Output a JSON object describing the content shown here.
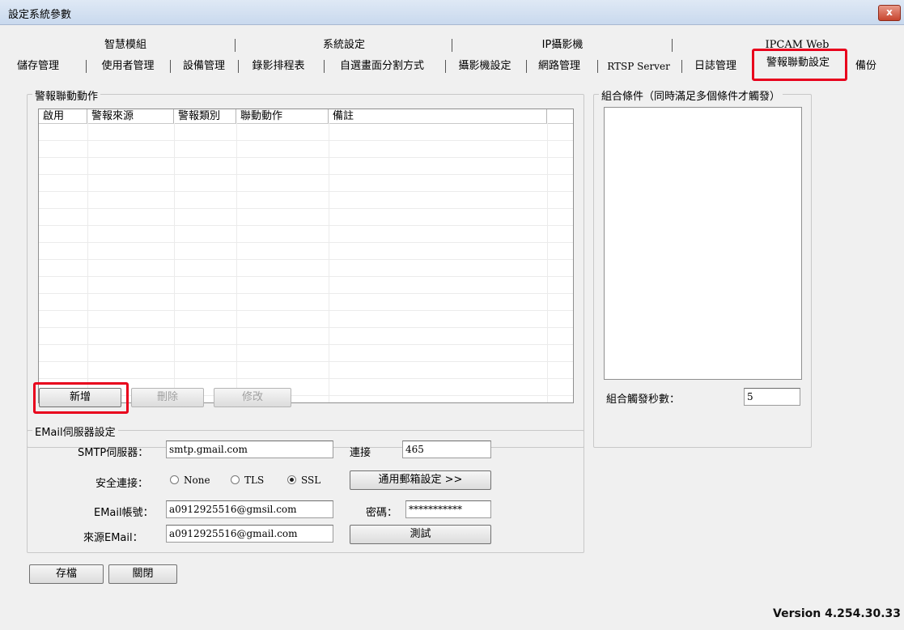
{
  "window": {
    "title": "設定系統參數",
    "close_label": "x"
  },
  "tabs": {
    "top_row": [
      "智慧模組",
      "系統設定",
      "IP攝影機",
      "IPCAM Web"
    ],
    "bottom_row": [
      "儲存管理",
      "使用者管理",
      "設備管理",
      "錄影排程表",
      "自選畫面分割方式",
      "攝影機設定",
      "網路管理",
      "RTSP Server",
      "日誌管理",
      "警報聯動設定",
      "備份"
    ],
    "active": "警報聯動設定"
  },
  "alarm_group": {
    "label": "警報聯動動作",
    "columns": [
      "啟用",
      "警報來源",
      "警報類別",
      "聯動動作",
      "備註"
    ],
    "rows": [],
    "buttons": {
      "add": "新增",
      "delete": "刪除",
      "modify": "修改"
    }
  },
  "combo_group": {
    "label": "組合條件（同時滿足多個條件才觸發）",
    "seconds_label": "組合觸發秒數：",
    "seconds_value": "5"
  },
  "email_group": {
    "label": "EMail伺服器設定",
    "smtp_label": "SMTP伺服器：",
    "smtp_value": "smtp.gmail.com",
    "port_label": "連接",
    "port_value": "465",
    "secure_label": "安全連接：",
    "secure_options": [
      "None",
      "TLS",
      "SSL"
    ],
    "secure_selected": "SSL",
    "general_mail_button": "通用郵箱設定 >>",
    "account_label": "EMail帳號：",
    "account_value": "a0912925516@gmsil.com",
    "password_label": "密碼：",
    "password_value": "***********",
    "source_label": "來源EMail：",
    "source_value": "a0912925516@gmail.com",
    "test_button": "測試"
  },
  "footer": {
    "save": "存檔",
    "close": "關閉",
    "version": "Version 4.254.30.33"
  },
  "colors": {
    "highlight": "#e8001c",
    "titlebar": "#c9d9ee",
    "dialog_bg": "#f0f0f0"
  }
}
